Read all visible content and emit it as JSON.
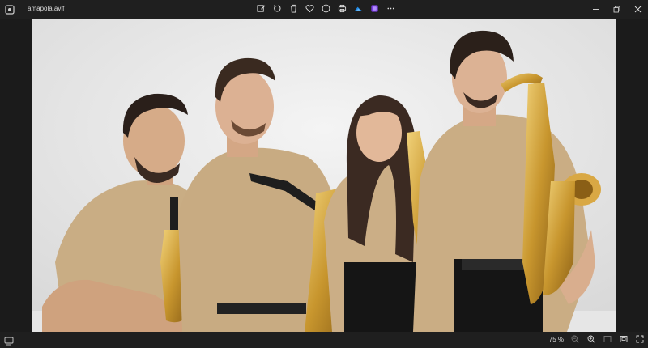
{
  "window": {
    "file_name": "amapola.avif"
  },
  "toolbar": {
    "tools": [
      {
        "name": "edit-icon"
      },
      {
        "name": "rotate-icon"
      },
      {
        "name": "delete-icon"
      },
      {
        "name": "favorite-heart-icon"
      },
      {
        "name": "info-icon"
      },
      {
        "name": "print-icon"
      },
      {
        "name": "cloud-onedrive-icon"
      },
      {
        "name": "clipchamp-icon"
      },
      {
        "name": "more-icon"
      }
    ]
  },
  "status": {
    "zoom": "75 %"
  }
}
